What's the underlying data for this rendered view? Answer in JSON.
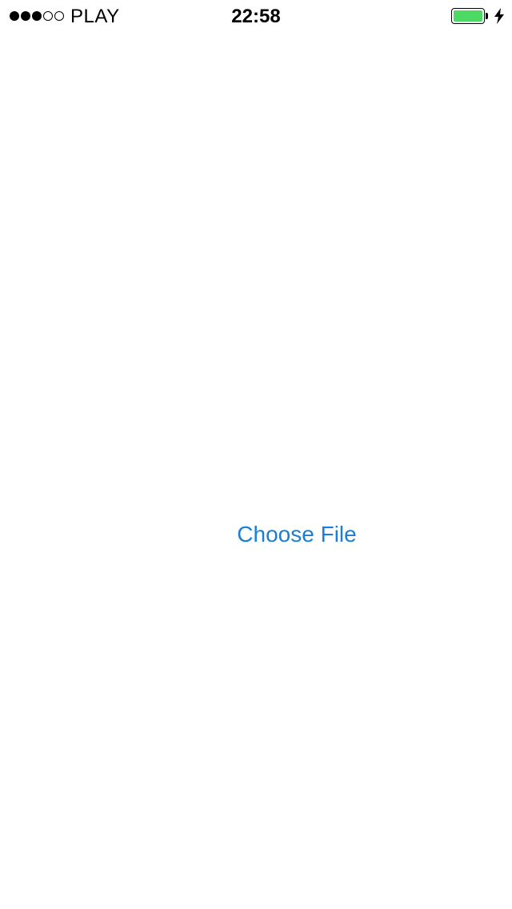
{
  "status_bar": {
    "signal": {
      "filled": 3,
      "total": 5
    },
    "carrier": "PLAY",
    "time": "22:58",
    "battery": {
      "level": 1.0,
      "charging": true,
      "color": "#4cd964"
    }
  },
  "main": {
    "choose_file_label": "Choose File",
    "accent_color": "#1a7fd4"
  }
}
